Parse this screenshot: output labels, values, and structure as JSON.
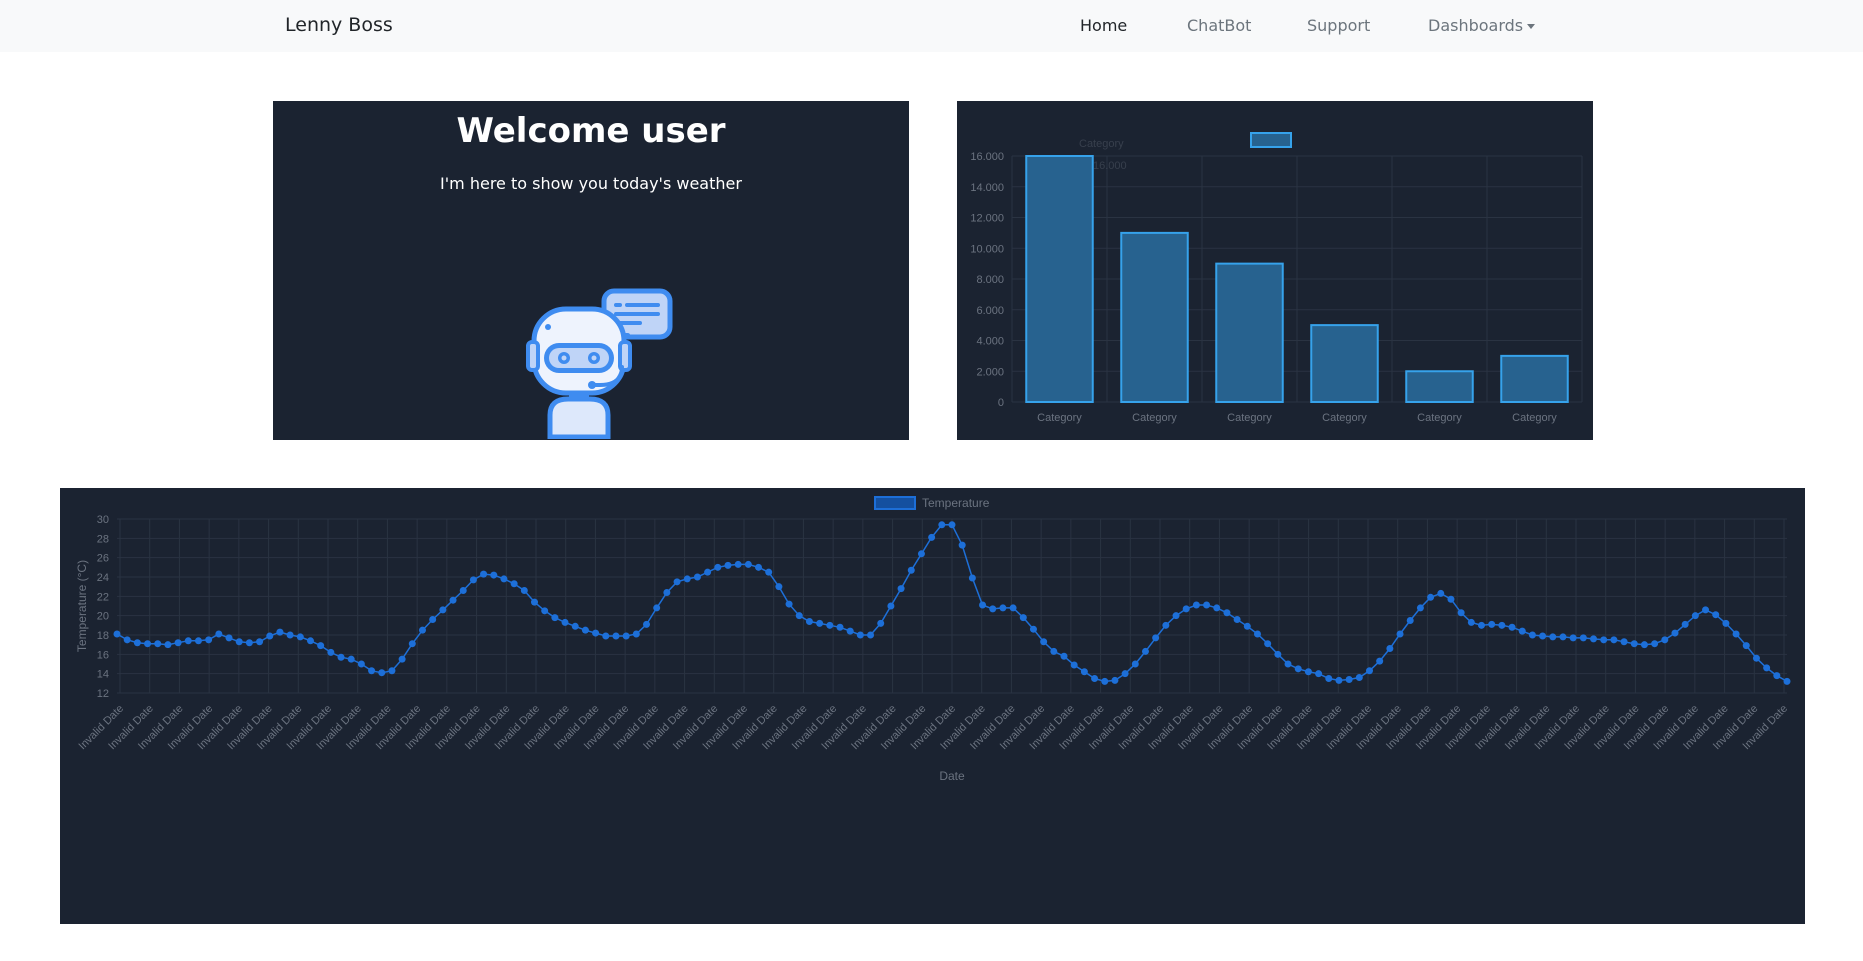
{
  "navbar": {
    "brand": "Lenny Boss",
    "links": [
      {
        "label": "Home"
      },
      {
        "label": "ChatBot"
      },
      {
        "label": "Support"
      },
      {
        "label": "Dashboards"
      }
    ]
  },
  "welcome": {
    "title": "Welcome user",
    "subtitle": "I'm here to show you today's weather"
  },
  "colors": {
    "panel_bg": "#1b2331",
    "bar_fill": "#27628f",
    "bar_border": "#36a2eb",
    "line": "#1d6fd8",
    "axis_text": "#6b7380",
    "grid": "#2a3342"
  },
  "chart_data": [
    {
      "type": "bar",
      "categories": [
        "Category",
        "Category",
        "Category",
        "Category",
        "Category",
        "Category"
      ],
      "values": [
        16000,
        11000,
        9000,
        5000,
        2000,
        3000
      ],
      "y_ticks": [
        "0",
        "2.000",
        "4.000",
        "6.000",
        "8.000",
        "10.000",
        "12.000",
        "14.000",
        "16.000"
      ],
      "ylim": [
        0,
        16000
      ],
      "grid": true,
      "legend_placement": "top",
      "tooltip": {
        "title": "Category",
        "value": "16.000"
      }
    },
    {
      "type": "line",
      "series": [
        {
          "name": "Temperature",
          "values": [
            18.1,
            17.5,
            17.2,
            17.1,
            17.1,
            17.0,
            17.2,
            17.4,
            17.4,
            17.5,
            18.1,
            17.7,
            17.3,
            17.2,
            17.3,
            17.9,
            18.3,
            18.0,
            17.8,
            17.4,
            16.9,
            16.2,
            15.7,
            15.5,
            15.0,
            14.3,
            14.1,
            14.3,
            15.5,
            17.1,
            18.5,
            19.6,
            20.6,
            21.6,
            22.6,
            23.7,
            24.3,
            24.2,
            23.8,
            23.3,
            22.6,
            21.4,
            20.5,
            19.8,
            19.3,
            18.9,
            18.5,
            18.2,
            17.9,
            17.9,
            17.9,
            18.1,
            19.1,
            20.8,
            22.4,
            23.5,
            23.8,
            24.0,
            24.5,
            25.0,
            25.2,
            25.3,
            25.3,
            25.0,
            24.5,
            23.0,
            21.2,
            20.0,
            19.4,
            19.2,
            19.0,
            18.8,
            18.4,
            18.0,
            18.0,
            19.2,
            21.0,
            22.8,
            24.7,
            26.4,
            28.1,
            29.4,
            29.4,
            27.3,
            23.9,
            21.1,
            20.7,
            20.8,
            20.8,
            19.8,
            18.6,
            17.3,
            16.3,
            15.8,
            14.9,
            14.2,
            13.5,
            13.2,
            13.3,
            14.0,
            15.0,
            16.3,
            17.7,
            19.0,
            20.0,
            20.7,
            21.1,
            21.1,
            20.8,
            20.3,
            19.6,
            18.9,
            18.1,
            17.1,
            16.0,
            15.0,
            14.5,
            14.2,
            14.0,
            13.5,
            13.3,
            13.4,
            13.6,
            14.3,
            15.3,
            16.6,
            18.1,
            19.5,
            20.8,
            21.9,
            22.3,
            21.7,
            20.3,
            19.3,
            19.0,
            19.1,
            19.0,
            18.8,
            18.4,
            18.0,
            17.9,
            17.8,
            17.8,
            17.7,
            17.7,
            17.6,
            17.5,
            17.5,
            17.3,
            17.1,
            17.0,
            17.1,
            17.5,
            18.2,
            19.1,
            20.0,
            20.6,
            20.1,
            19.2,
            18.1,
            16.9,
            15.6,
            14.6,
            13.8,
            13.2
          ]
        }
      ],
      "x_tick_label": "Invalid Date",
      "x_tick_count": 57,
      "xlabel": "Date",
      "ylabel": "Temperature (°C)",
      "y_ticks": [
        "12",
        "14",
        "16",
        "18",
        "20",
        "22",
        "24",
        "26",
        "28",
        "30"
      ],
      "ylim": [
        12,
        30
      ],
      "grid": true,
      "legend_placement": "top"
    }
  ]
}
